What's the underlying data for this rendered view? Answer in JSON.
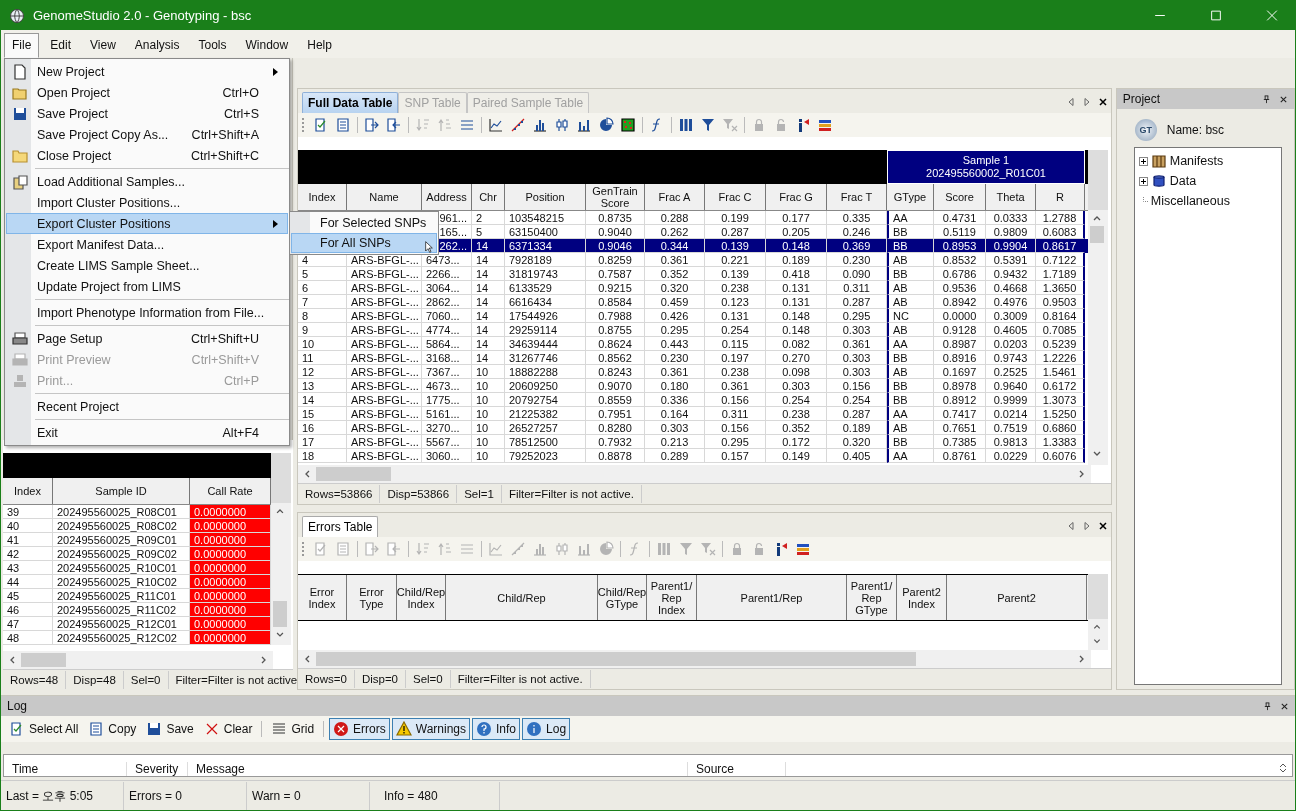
{
  "window": {
    "title": "GenomeStudio 2.0 - Genotyping - bsc"
  },
  "menubar": [
    {
      "label": "File",
      "selected": true
    },
    {
      "label": "Edit",
      "selected": false
    },
    {
      "label": "View",
      "selected": false
    },
    {
      "label": "Analysis",
      "selected": false
    },
    {
      "label": "Tools",
      "selected": false
    },
    {
      "label": "Window",
      "selected": false
    },
    {
      "label": "Help",
      "selected": false
    }
  ],
  "file_menu": {
    "groups": [
      [
        {
          "label": "New Project",
          "kind": "page",
          "submenu": true,
          "disabled": false,
          "selected": false
        },
        {
          "label": "Open Project",
          "kind": "folder-open",
          "shortcut": "Ctrl+O",
          "submenu": false,
          "disabled": false,
          "selected": false
        },
        {
          "label": "Save Project",
          "kind": "floppy",
          "shortcut": "Ctrl+S",
          "submenu": false,
          "disabled": false,
          "selected": false
        },
        {
          "label": "Save Project Copy As...",
          "kind": "plain",
          "shortcut": "Ctrl+Shift+A",
          "submenu": false,
          "disabled": false,
          "selected": false
        },
        {
          "label": "Close Project",
          "kind": "folder",
          "shortcut": "Ctrl+Shift+C",
          "submenu": false,
          "disabled": false,
          "selected": false
        }
      ],
      [
        {
          "label": "Load Additional Samples...",
          "kind": "clipboard",
          "submenu": false,
          "disabled": false,
          "selected": false
        },
        {
          "label": "Import Cluster Positions...",
          "kind": "plain",
          "submenu": false,
          "disabled": false,
          "selected": false
        },
        {
          "label": "Export Cluster Positions",
          "kind": "plain",
          "submenu": true,
          "disabled": false,
          "selected": true,
          "children": [
            {
              "label": "For Selected SNPs",
              "selected": false
            },
            {
              "label": "For All SNPs",
              "selected": true
            }
          ]
        },
        {
          "label": "Export Manifest Data...",
          "kind": "plain",
          "submenu": false,
          "disabled": false,
          "selected": false
        },
        {
          "label": "Create LIMS Sample Sheet...",
          "kind": "plain",
          "submenu": false,
          "disabled": false,
          "selected": false
        },
        {
          "label": "Update Project from LIMS",
          "kind": "plain",
          "submenu": false,
          "disabled": false,
          "selected": false
        }
      ],
      [
        {
          "label": "Import Phenotype Information from File...",
          "kind": "plain",
          "submenu": false,
          "disabled": false,
          "selected": false
        }
      ],
      [
        {
          "label": "Page Setup",
          "kind": "printer",
          "shortcut": "Ctrl+Shift+U",
          "submenu": false,
          "disabled": false,
          "selected": false
        },
        {
          "label": "Print Preview",
          "kind": "printer",
          "shortcut": "Ctrl+Shift+V",
          "submenu": false,
          "disabled": true,
          "selected": false
        },
        {
          "label": "Print...",
          "kind": "stamp",
          "shortcut": "Ctrl+P",
          "submenu": false,
          "disabled": true,
          "selected": false
        }
      ],
      [
        {
          "label": "Recent Project",
          "kind": "plain",
          "submenu": false,
          "disabled": false,
          "selected": false
        }
      ],
      [
        {
          "label": "Exit",
          "kind": "plain",
          "shortcut": "Alt+F4",
          "submenu": false,
          "disabled": false,
          "selected": false
        }
      ]
    ]
  },
  "sample_table": {
    "columns": [
      "Index",
      "Sample ID",
      "Call Rate"
    ],
    "rows": [
      {
        "cells": [
          "39",
          "202495560025_R08C01",
          "0.0000000"
        ],
        "flagged": true
      },
      {
        "cells": [
          "40",
          "202495560025_R08C02",
          "0.0000000"
        ],
        "flagged": true
      },
      {
        "cells": [
          "41",
          "202495560025_R09C01",
          "0.0000000"
        ],
        "flagged": true
      },
      {
        "cells": [
          "42",
          "202495560025_R09C02",
          "0.0000000"
        ],
        "flagged": true
      },
      {
        "cells": [
          "43",
          "202495560025_R10C01",
          "0.0000000"
        ],
        "flagged": true
      },
      {
        "cells": [
          "44",
          "202495560025_R10C02",
          "0.0000000"
        ],
        "flagged": true
      },
      {
        "cells": [
          "45",
          "202495560025_R11C01",
          "0.0000000"
        ],
        "flagged": true
      },
      {
        "cells": [
          "46",
          "202495560025_R11C02",
          "0.0000000"
        ],
        "flagged": true
      },
      {
        "cells": [
          "47",
          "202495560025_R12C01",
          "0.0000000"
        ],
        "flagged": true
      },
      {
        "cells": [
          "48",
          "202495560025_R12C02",
          "0.0000000"
        ],
        "flagged": true
      }
    ],
    "status": [
      "Rows=48",
      "Disp=48",
      "Sel=0",
      "Filter=Filter is not active"
    ]
  },
  "data_panel": {
    "tabs": [
      {
        "label": "Full Data Table",
        "selected": true
      },
      {
        "label": "SNP Table",
        "selected": false
      },
      {
        "label": "Paired Sample Table",
        "selected": false
      }
    ],
    "toolbar": [
      {
        "kind": "checklist",
        "disabled": false
      },
      {
        "kind": "list",
        "disabled": false
      },
      {
        "kind": "separator"
      },
      {
        "kind": "page-arrow-right",
        "disabled": false
      },
      {
        "kind": "page-arrow-left",
        "disabled": false
      },
      {
        "kind": "separator"
      },
      {
        "kind": "sort-down",
        "disabled": true
      },
      {
        "kind": "sort-up",
        "disabled": true
      },
      {
        "kind": "sort",
        "disabled": false
      },
      {
        "kind": "separator"
      },
      {
        "kind": "line-chart",
        "disabled": false
      },
      {
        "kind": "scatter",
        "disabled": false
      },
      {
        "kind": "bar-chart",
        "disabled": false
      },
      {
        "kind": "box-plot",
        "disabled": false
      },
      {
        "kind": "histogram",
        "disabled": false
      },
      {
        "kind": "pie-chart",
        "disabled": false
      },
      {
        "kind": "heatmap",
        "disabled": false
      },
      {
        "kind": "separator"
      },
      {
        "kind": "function",
        "disabled": false
      },
      {
        "kind": "separator"
      },
      {
        "kind": "columns",
        "disabled": false
      },
      {
        "kind": "filter",
        "disabled": false
      },
      {
        "kind": "filter-clear",
        "disabled": true
      },
      {
        "kind": "separator"
      },
      {
        "kind": "lock",
        "disabled": true
      },
      {
        "kind": "unlock",
        "disabled": true
      },
      {
        "kind": "marker",
        "disabled": false
      },
      {
        "kind": "color-bars",
        "disabled": false
      }
    ],
    "sample_header": {
      "title": "Sample 1",
      "id": "202495560002_R01C01"
    },
    "columns": [
      "Index",
      "Name",
      "Address",
      "Chr",
      "Position",
      "GenTrain Score",
      "Frac A",
      "Frac C",
      "Frac G",
      "Frac T",
      "GType",
      "Score",
      "Theta",
      "R"
    ],
    "rows": [
      {
        "selected": false,
        "cells": [
          null,
          null,
          "961...",
          "2",
          "103548215",
          "0.8735",
          "0.288",
          "0.199",
          "0.177",
          "0.335",
          "AA",
          "0.4731",
          "0.0333",
          "1.2788"
        ]
      },
      {
        "selected": false,
        "cells": [
          null,
          null,
          "165...",
          "5",
          "63150400",
          "0.9040",
          "0.262",
          "0.287",
          "0.205",
          "0.246",
          "BB",
          "0.5119",
          "0.9809",
          "0.6083"
        ]
      },
      {
        "selected": true,
        "cells": [
          null,
          null,
          "262...",
          "14",
          "6371334",
          "0.9046",
          "0.344",
          "0.139",
          "0.148",
          "0.369",
          "BB",
          "0.8953",
          "0.9904",
          "0.8617"
        ]
      },
      {
        "selected": false,
        "cells": [
          "4",
          "ARS-BFGL-...",
          "6473...",
          "14",
          "7928189",
          "0.8259",
          "0.361",
          "0.221",
          "0.189",
          "0.230",
          "AB",
          "0.8532",
          "0.5391",
          "0.7122"
        ]
      },
      {
        "selected": false,
        "cells": [
          "5",
          "ARS-BFGL-...",
          "2266...",
          "14",
          "31819743",
          "0.7587",
          "0.352",
          "0.139",
          "0.418",
          "0.090",
          "BB",
          "0.6786",
          "0.9432",
          "1.7189"
        ]
      },
      {
        "selected": false,
        "cells": [
          "6",
          "ARS-BFGL-...",
          "3064...",
          "14",
          "6133529",
          "0.9215",
          "0.320",
          "0.238",
          "0.131",
          "0.311",
          "AB",
          "0.9536",
          "0.4668",
          "1.3650"
        ]
      },
      {
        "selected": false,
        "cells": [
          "7",
          "ARS-BFGL-...",
          "2862...",
          "14",
          "6616434",
          "0.8584",
          "0.459",
          "0.123",
          "0.131",
          "0.287",
          "AB",
          "0.8942",
          "0.4976",
          "0.9503"
        ]
      },
      {
        "selected": false,
        "cells": [
          "8",
          "ARS-BFGL-...",
          "7060...",
          "14",
          "17544926",
          "0.7988",
          "0.426",
          "0.131",
          "0.148",
          "0.295",
          "NC",
          "0.0000",
          "0.3009",
          "0.8164"
        ]
      },
      {
        "selected": false,
        "cells": [
          "9",
          "ARS-BFGL-...",
          "4774...",
          "14",
          "29259114",
          "0.8755",
          "0.295",
          "0.254",
          "0.148",
          "0.303",
          "AB",
          "0.9128",
          "0.4605",
          "0.7085"
        ]
      },
      {
        "selected": false,
        "cells": [
          "10",
          "ARS-BFGL-...",
          "5864...",
          "14",
          "34639444",
          "0.8624",
          "0.443",
          "0.115",
          "0.082",
          "0.361",
          "AA",
          "0.8987",
          "0.0203",
          "0.5239"
        ]
      },
      {
        "selected": false,
        "cells": [
          "11",
          "ARS-BFGL-...",
          "3168...",
          "14",
          "31267746",
          "0.8562",
          "0.230",
          "0.197",
          "0.270",
          "0.303",
          "BB",
          "0.8916",
          "0.9743",
          "1.2226"
        ]
      },
      {
        "selected": false,
        "cells": [
          "12",
          "ARS-BFGL-...",
          "7367...",
          "10",
          "18882288",
          "0.8243",
          "0.361",
          "0.238",
          "0.098",
          "0.303",
          "AB",
          "0.1697",
          "0.2525",
          "1.5461"
        ]
      },
      {
        "selected": false,
        "cells": [
          "13",
          "ARS-BFGL-...",
          "4673...",
          "10",
          "20609250",
          "0.9070",
          "0.180",
          "0.361",
          "0.303",
          "0.156",
          "BB",
          "0.8978",
          "0.9640",
          "0.6172"
        ]
      },
      {
        "selected": false,
        "cells": [
          "14",
          "ARS-BFGL-...",
          "1775...",
          "10",
          "20792754",
          "0.8559",
          "0.336",
          "0.156",
          "0.254",
          "0.254",
          "BB",
          "0.8912",
          "0.9999",
          "1.3073"
        ]
      },
      {
        "selected": false,
        "cells": [
          "15",
          "ARS-BFGL-...",
          "5161...",
          "10",
          "21225382",
          "0.7951",
          "0.164",
          "0.311",
          "0.238",
          "0.287",
          "AA",
          "0.7417",
          "0.0214",
          "1.5250"
        ]
      },
      {
        "selected": false,
        "cells": [
          "16",
          "ARS-BFGL-...",
          "3270...",
          "10",
          "26527257",
          "0.8280",
          "0.303",
          "0.156",
          "0.352",
          "0.189",
          "AB",
          "0.7651",
          "0.7519",
          "0.6860"
        ]
      },
      {
        "selected": false,
        "cells": [
          "17",
          "ARS-BFGL-...",
          "5567...",
          "10",
          "78512500",
          "0.7932",
          "0.213",
          "0.295",
          "0.172",
          "0.320",
          "BB",
          "0.7385",
          "0.9813",
          "1.3383"
        ]
      },
      {
        "selected": false,
        "cells": [
          "18",
          "ARS-BFGL-...",
          "3060...",
          "10",
          "79252023",
          "0.8878",
          "0.289",
          "0.157",
          "0.149",
          "0.405",
          "AA",
          "0.8761",
          "0.0229",
          "0.6076"
        ]
      }
    ],
    "status": [
      "Rows=53866",
      "Disp=53866",
      "Sel=1",
      "Filter=Filter is not active."
    ]
  },
  "errors_panel": {
    "tabs": [
      {
        "label": "Errors Table",
        "selected": true
      }
    ],
    "toolbar": [
      {
        "kind": "checklist",
        "disabled": true
      },
      {
        "kind": "list",
        "disabled": true
      },
      {
        "kind": "separator"
      },
      {
        "kind": "page-arrow-right",
        "disabled": true
      },
      {
        "kind": "page-arrow-left",
        "disabled": true
      },
      {
        "kind": "separator"
      },
      {
        "kind": "sort-down",
        "disabled": true
      },
      {
        "kind": "sort-up",
        "disabled": true
      },
      {
        "kind": "sort",
        "disabled": true
      },
      {
        "kind": "separator"
      },
      {
        "kind": "line-chart",
        "disabled": true
      },
      {
        "kind": "scatter",
        "disabled": true
      },
      {
        "kind": "bar-chart",
        "disabled": true
      },
      {
        "kind": "box-plot",
        "disabled": true
      },
      {
        "kind": "histogram",
        "disabled": true
      },
      {
        "kind": "pie-chart",
        "disabled": true
      },
      {
        "kind": "separator"
      },
      {
        "kind": "function",
        "disabled": true
      },
      {
        "kind": "separator"
      },
      {
        "kind": "columns",
        "disabled": true
      },
      {
        "kind": "filter",
        "disabled": true
      },
      {
        "kind": "filter-clear",
        "disabled": true
      },
      {
        "kind": "separator"
      },
      {
        "kind": "lock",
        "disabled": true
      },
      {
        "kind": "unlock",
        "disabled": true
      },
      {
        "kind": "marker",
        "disabled": false
      },
      {
        "kind": "color-bars",
        "disabled": false
      }
    ],
    "columns": [
      "Error Index",
      "Error Type",
      "Child/Rep Index",
      "Child/Rep",
      "Child/Rep GType",
      "Parent1/ Rep Index",
      "Parent1/Rep",
      "Parent1/ Rep GType",
      "Parent2 Index",
      "Parent2"
    ],
    "status": [
      "Rows=0",
      "Disp=0",
      "Sel=0",
      "Filter=Filter is not active."
    ]
  },
  "project": {
    "title": "Project",
    "badge": "GT",
    "name": "Name: bsc",
    "tree": [
      {
        "label": "Manifests",
        "kind": "books",
        "expandable": true,
        "expanded": false
      },
      {
        "label": "Data",
        "kind": "database",
        "expandable": true,
        "expanded": false
      },
      {
        "label": "Miscellaneous",
        "kind": "plain",
        "expandable": false
      }
    ]
  },
  "log": {
    "title": "Log",
    "tools": [
      {
        "label": "Select All",
        "kind": "checklist",
        "selected": false
      },
      {
        "label": "Copy",
        "kind": "list",
        "selected": false
      },
      {
        "label": "Save",
        "kind": "floppy",
        "selected": false
      },
      {
        "label": "Clear",
        "kind": "cross",
        "selected": false
      },
      {
        "label": "Grid",
        "kind": "grid",
        "selected": false
      },
      {
        "label": "Errors",
        "kind": "error-circle",
        "selected": true
      },
      {
        "label": "Warnings",
        "kind": "warning-triangle",
        "selected": true
      },
      {
        "label": "Info",
        "kind": "help-circle",
        "selected": true
      },
      {
        "label": "Log",
        "kind": "info-circle",
        "selected": true
      }
    ],
    "columns": [
      "Time",
      "Severity",
      "Message",
      "Source"
    ]
  },
  "status_bar": [
    "Last = 오후 5:05",
    "Errors = 0",
    "Warn = 0",
    "Info = 480"
  ]
}
